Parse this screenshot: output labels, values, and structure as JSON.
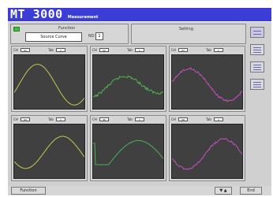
{
  "titlebar": {
    "app_name": "MT 3000",
    "subtitle": "Measurement"
  },
  "function": {
    "title": "Function",
    "mode": "Source Curve",
    "no_label": "NO",
    "no_value": "1"
  },
  "setting": {
    "title": "Setting"
  },
  "channels": [
    {
      "ch_label": "CH",
      "ch_value": "01",
      "tab_label": "Tab",
      "tab_value": "1",
      "trace_color": "#c8c850"
    },
    {
      "ch_label": "CH",
      "ch_value": "02",
      "tab_label": "Tab",
      "tab_value": "1",
      "trace_color": "#50b050"
    },
    {
      "ch_label": "CH",
      "ch_value": "03",
      "tab_label": "Tab",
      "tab_value": "1",
      "trace_color": "#c050c0"
    },
    {
      "ch_label": "CH",
      "ch_value": "04",
      "tab_label": "Tab",
      "tab_value": "1",
      "trace_color": "#c8c850"
    },
    {
      "ch_label": "CH",
      "ch_value": "05",
      "tab_label": "Tab",
      "tab_value": "1",
      "trace_color": "#50b050"
    },
    {
      "ch_label": "CH",
      "ch_value": "06",
      "tab_label": "Tab",
      "tab_value": "1",
      "trace_color": "#c050c0"
    }
  ],
  "toolbar": {
    "buttons": [
      "layout-2x3-icon",
      "layout-list-icon",
      "layout-list-icon",
      "layout-list-icon"
    ]
  },
  "bottombar": {
    "function_label": "Function",
    "arrows_label": "▼ ▲",
    "end_label": "End"
  },
  "colors": {
    "title_bg": "#3c3cd6",
    "panel_bg": "#d0d0d0",
    "plot_bg": "#404040"
  }
}
